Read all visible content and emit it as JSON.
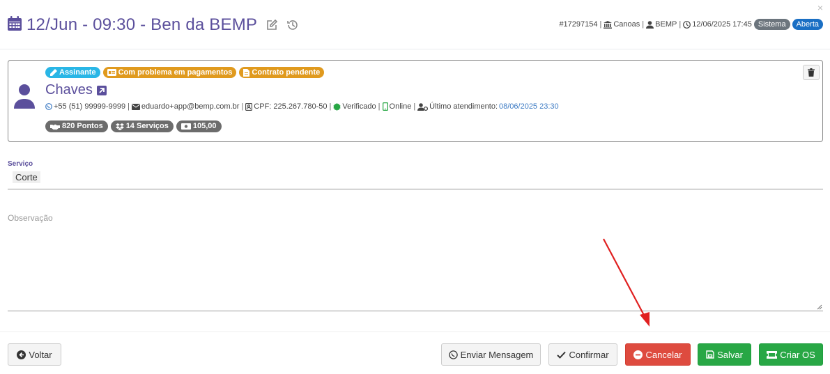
{
  "header": {
    "title": "12/Jun - 09:30 - Ben da BEMP",
    "id": "#17297154",
    "location": "Canoas",
    "user": "BEMP",
    "datetime": "12/06/2025 17:45",
    "badges": [
      {
        "label": "Sistema",
        "color": "#6c757d"
      },
      {
        "label": "Aberta",
        "color": "#1a6fc4"
      }
    ],
    "close": "×"
  },
  "client": {
    "tags": [
      {
        "label": "Assinante",
        "color": "#29b6e6",
        "icon": "pencil-icon"
      },
      {
        "label": "Com problema em pagamentos",
        "color": "#e09a1e",
        "icon": "id-card-icon"
      },
      {
        "label": "Contrato pendente",
        "color": "#e09a1e",
        "icon": "document-icon"
      }
    ],
    "name": "Chaves",
    "phone": "+55 (51) 99999-9999",
    "email": "eduardo+app@bemp.com.br",
    "cpf": "CPF: 225.267.780-50",
    "verified": "Verificado",
    "online": "Online",
    "last_attendance_label": "Último atendimento:",
    "last_attendance_value": "08/06/2025 23:30",
    "stats": [
      {
        "label": "820 Pontos",
        "icon": "handshake-icon"
      },
      {
        "label": "14 Serviços",
        "icon": "dropbox-icon"
      },
      {
        "label": "105,00",
        "icon": "money-icon"
      }
    ]
  },
  "service": {
    "label": "Serviço",
    "value": "Corte"
  },
  "observation": {
    "placeholder": "Observação"
  },
  "footer": {
    "back": "Voltar",
    "send_message": "Enviar Mensagem",
    "confirm": "Confirmar",
    "cancel": "Cancelar",
    "save": "Salvar",
    "create_os": "Criar OS"
  },
  "colors": {
    "accent": "#5b4f9c",
    "link": "#3d7bc4",
    "cancel": "#de4b3f",
    "success": "#28a745"
  }
}
